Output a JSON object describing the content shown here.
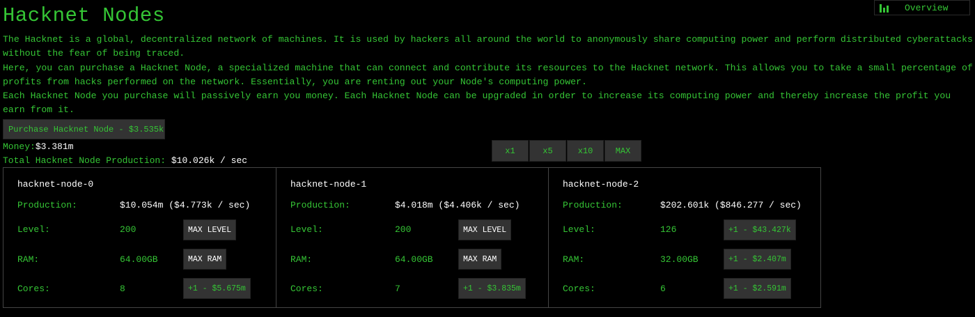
{
  "title": "Hacknet Nodes",
  "overview_label": "Overview",
  "description": [
    "The Hacknet is a global, decentralized network of machines. It is used by hackers all around the world to anonymously share computing power and perform distributed cyberattacks without the fear of being traced.",
    "Here, you can purchase a Hacknet Node, a specialized machine that can connect and contribute its resources to the Hacknet network. This allows you to take a small percentage of profits from hacks performed on the network. Essentially, you are renting out your Node's computing power.",
    "Each Hacknet Node you purchase will passively earn you money. Each Hacknet Node can be upgraded in order to increase its computing power and thereby increase the profit you earn from it."
  ],
  "purchase_label": "Purchase Hacknet Node - $3.535k",
  "money_label": "Money:",
  "money_value": "$3.381m",
  "production_label": "Total Hacknet Node Production: ",
  "production_value": "$10.026k / sec",
  "multipliers": [
    "x1",
    "x5",
    "x10",
    "MAX"
  ],
  "row_labels": {
    "production": "Production:",
    "level": "Level:",
    "ram": "RAM:",
    "cores": "Cores:"
  },
  "nodes": [
    {
      "name": "hacknet-node-0",
      "production": "$10.054m",
      "rate": "($4.773k / sec)",
      "level": "200",
      "level_btn": "MAX LEVEL",
      "ram": "64.00GB",
      "ram_btn": "MAX RAM",
      "cores": "8",
      "cores_btn": "+1 - $5.675m"
    },
    {
      "name": "hacknet-node-1",
      "production": "$4.018m",
      "rate": "($4.406k / sec)",
      "level": "200",
      "level_btn": "MAX LEVEL",
      "ram": "64.00GB",
      "ram_btn": "MAX RAM",
      "cores": "7",
      "cores_btn": "+1 - $3.835m"
    },
    {
      "name": "hacknet-node-2",
      "production": "$202.601k",
      "rate": "($846.277 / sec)",
      "level": "126",
      "level_btn": "+1 - $43.427k",
      "ram": "32.00GB",
      "ram_btn": "+1 - $2.407m",
      "cores": "6",
      "cores_btn": "+1 - $2.591m"
    }
  ],
  "colors": {
    "background": "#000000",
    "text": "#35c535",
    "button_bg": "#333333",
    "value": "#ffffff"
  }
}
